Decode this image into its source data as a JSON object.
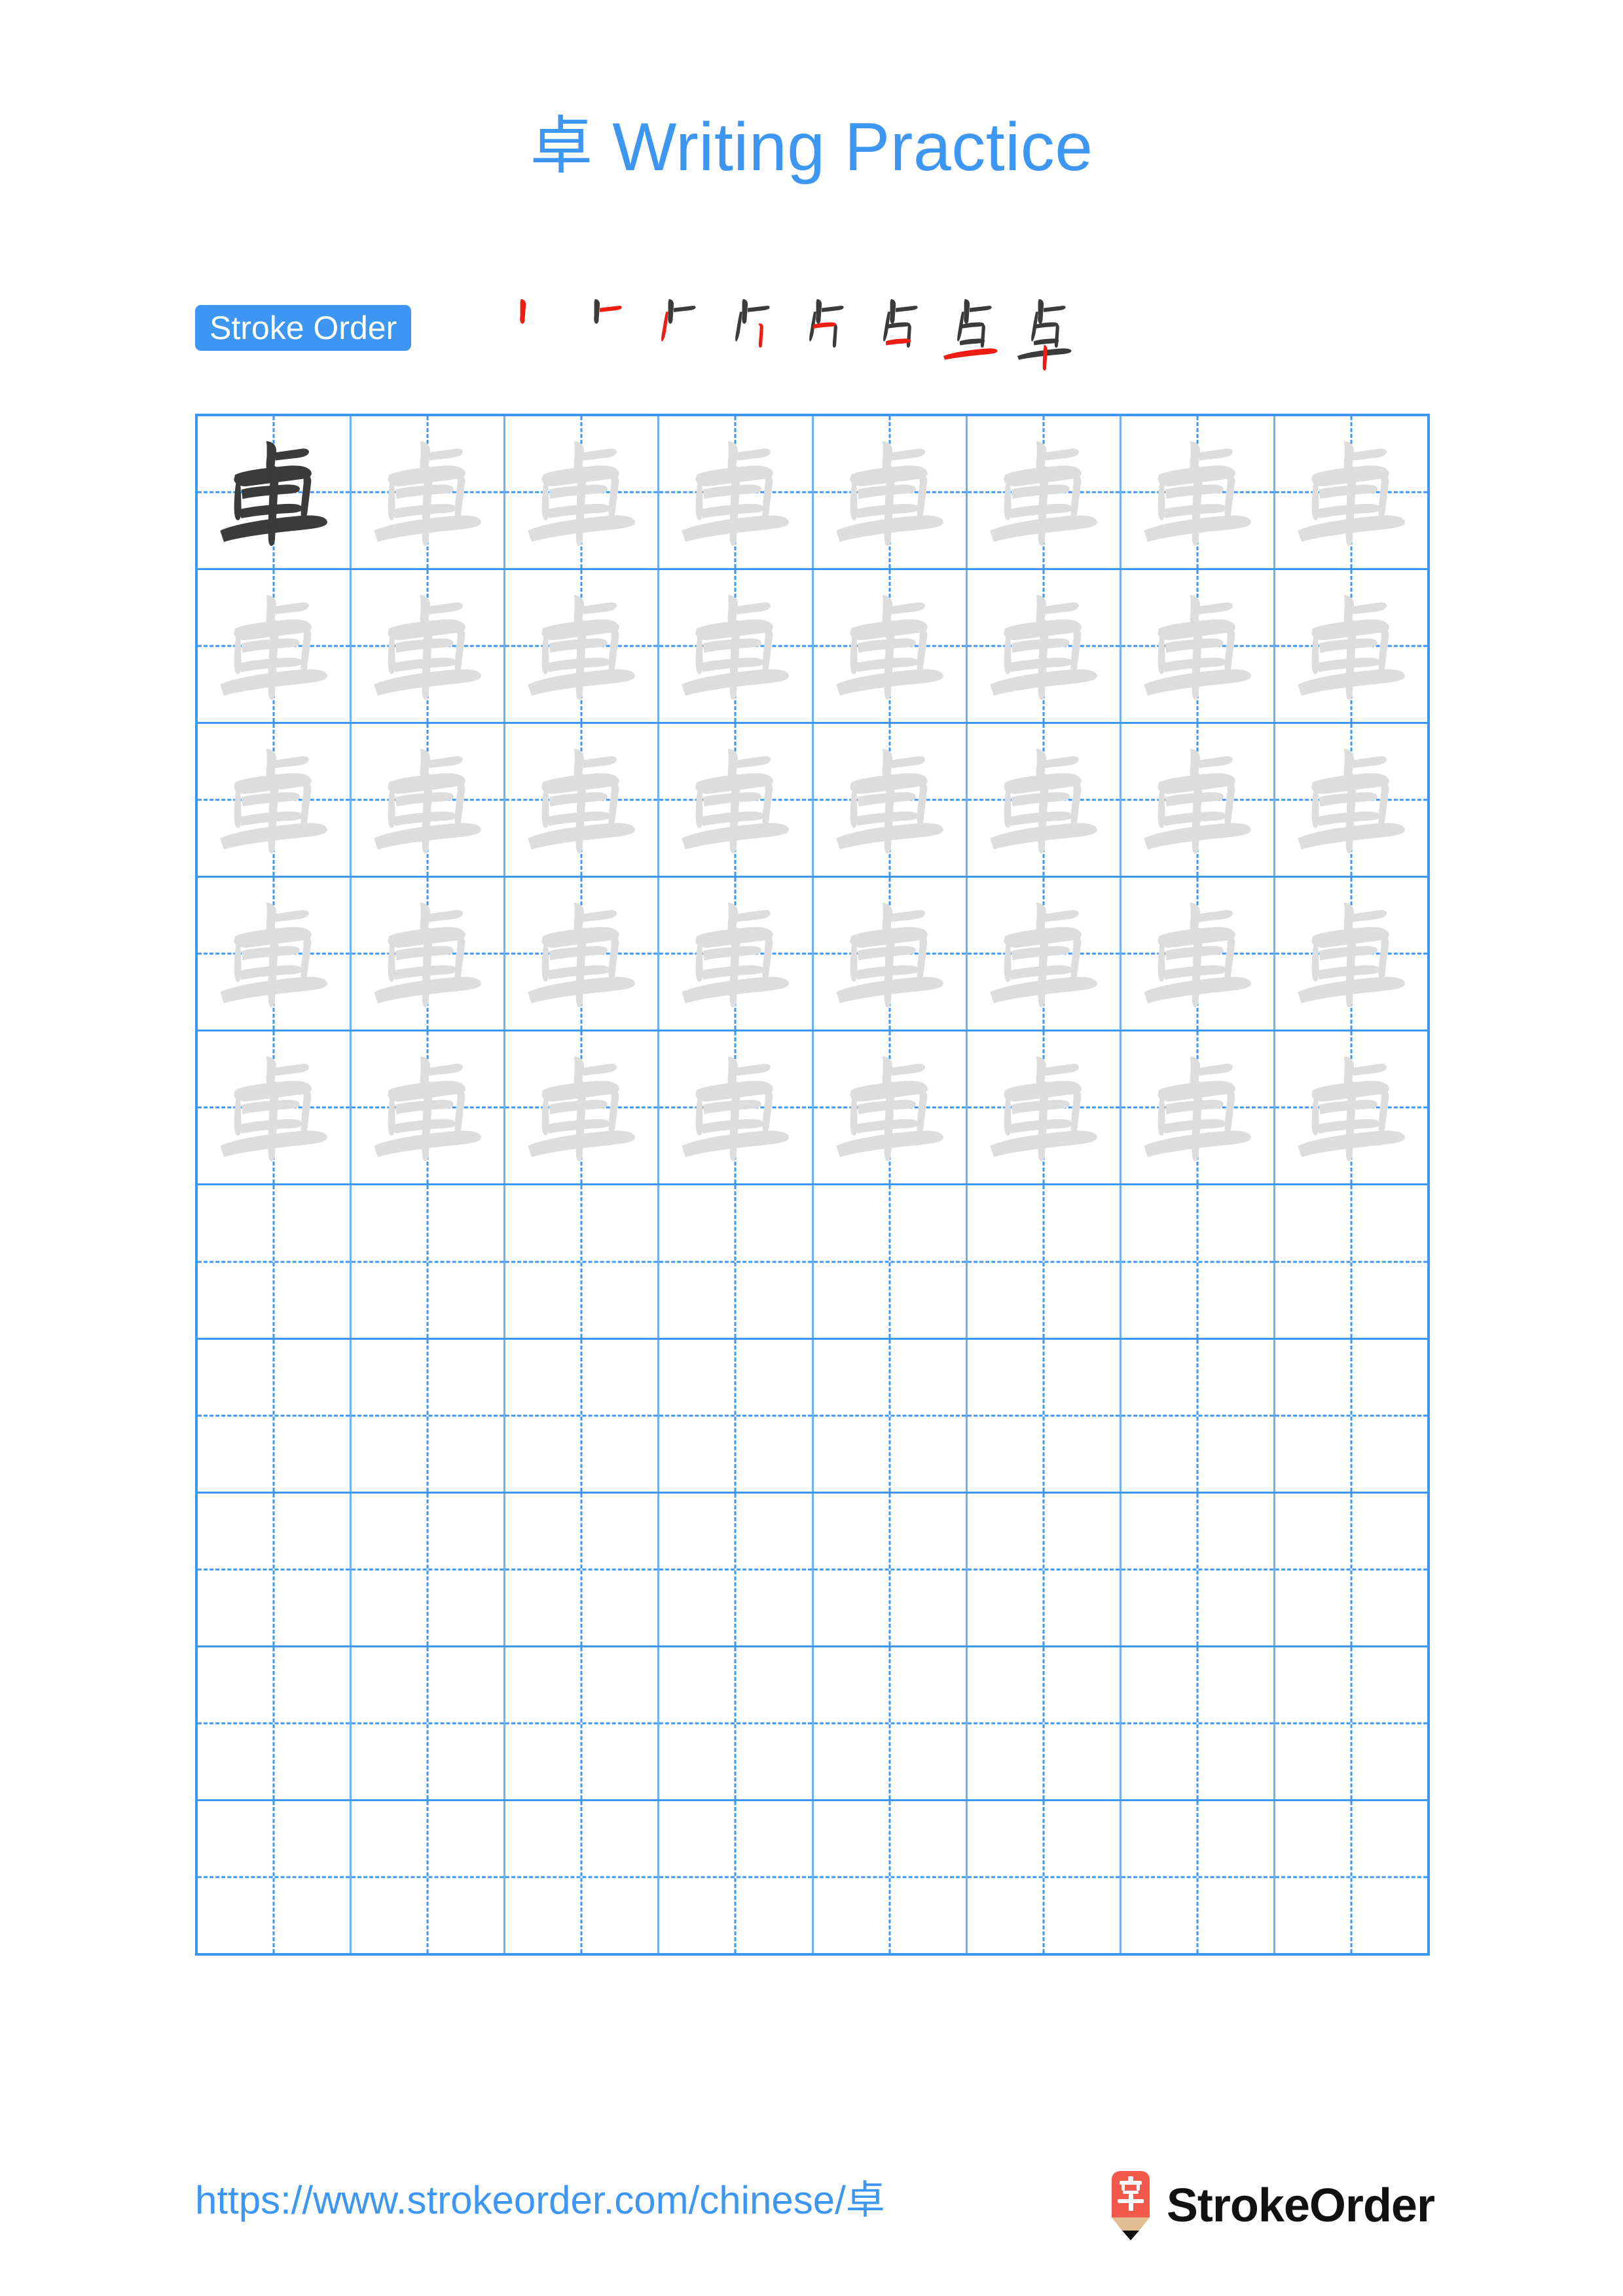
{
  "character": "卓",
  "title": {
    "han": "卓",
    "text": " Writing Practice",
    "full": "卓 Writing Practice",
    "color": "#3d97f2"
  },
  "stroke_order": {
    "badge_label": "Stroke Order",
    "badge_bg": "#3d97f2",
    "badge_text_color": "#ffffff",
    "total_strokes": 8,
    "new_stroke_color": "#ee1c11",
    "existing_stroke_color": "#3b3b3b",
    "steps": [
      {
        "index": 1,
        "partial": "丨",
        "new_stroke": "vertical-left-dot"
      },
      {
        "index": 2,
        "partial": "卜",
        "new_stroke": "horizontal-right-tick"
      },
      {
        "index": 3,
        "partial": "⺊",
        "new_stroke": "vertical-long"
      },
      {
        "index": 4,
        "partial": "占",
        "new_stroke": "vertical-box-left"
      },
      {
        "index": 5,
        "partial": "占",
        "new_stroke": "horizontal-box-middle"
      },
      {
        "index": 6,
        "partial": "占",
        "new_stroke": "horizontal-box-bottom"
      },
      {
        "index": 7,
        "partial": "卓",
        "new_stroke": "long-horizontal"
      },
      {
        "index": 8,
        "partial": "卓",
        "new_stroke": "final-vertical"
      }
    ]
  },
  "practice_grid": {
    "columns": 8,
    "rows": 10,
    "grid_border_color": "#3d97f2",
    "guide_line_color": "#3d97f2",
    "dark_char_color": "#3b3b3b",
    "trace_char_color": "#dddddd",
    "rows_data": [
      {
        "row": 1,
        "cells": [
          "dark",
          "trace",
          "trace",
          "trace",
          "trace",
          "trace",
          "trace",
          "trace"
        ]
      },
      {
        "row": 2,
        "cells": [
          "trace",
          "trace",
          "trace",
          "trace",
          "trace",
          "trace",
          "trace",
          "trace"
        ]
      },
      {
        "row": 3,
        "cells": [
          "trace",
          "trace",
          "trace",
          "trace",
          "trace",
          "trace",
          "trace",
          "trace"
        ]
      },
      {
        "row": 4,
        "cells": [
          "trace",
          "trace",
          "trace",
          "trace",
          "trace",
          "trace",
          "trace",
          "trace"
        ]
      },
      {
        "row": 5,
        "cells": [
          "trace",
          "trace",
          "trace",
          "trace",
          "trace",
          "trace",
          "trace",
          "trace"
        ]
      },
      {
        "row": 6,
        "cells": [
          "empty",
          "empty",
          "empty",
          "empty",
          "empty",
          "empty",
          "empty",
          "empty"
        ]
      },
      {
        "row": 7,
        "cells": [
          "empty",
          "empty",
          "empty",
          "empty",
          "empty",
          "empty",
          "empty",
          "empty"
        ]
      },
      {
        "row": 8,
        "cells": [
          "empty",
          "empty",
          "empty",
          "empty",
          "empty",
          "empty",
          "empty",
          "empty"
        ]
      },
      {
        "row": 9,
        "cells": [
          "empty",
          "empty",
          "empty",
          "empty",
          "empty",
          "empty",
          "empty",
          "empty"
        ]
      },
      {
        "row": 10,
        "cells": [
          "empty",
          "empty",
          "empty",
          "empty",
          "empty",
          "empty",
          "empty",
          "empty"
        ]
      }
    ]
  },
  "footer": {
    "url": "https://www.strokeorder.com/chinese/卓",
    "url_color": "#3d97f2",
    "brand": "StrokeOrder",
    "brand_color": "#111111",
    "logo_icon": "pencil-icon",
    "logo_glyph": "字",
    "logo_body_color": "#f2594b",
    "logo_wood_color": "#e0bd92",
    "logo_tip_color": "#111111"
  }
}
